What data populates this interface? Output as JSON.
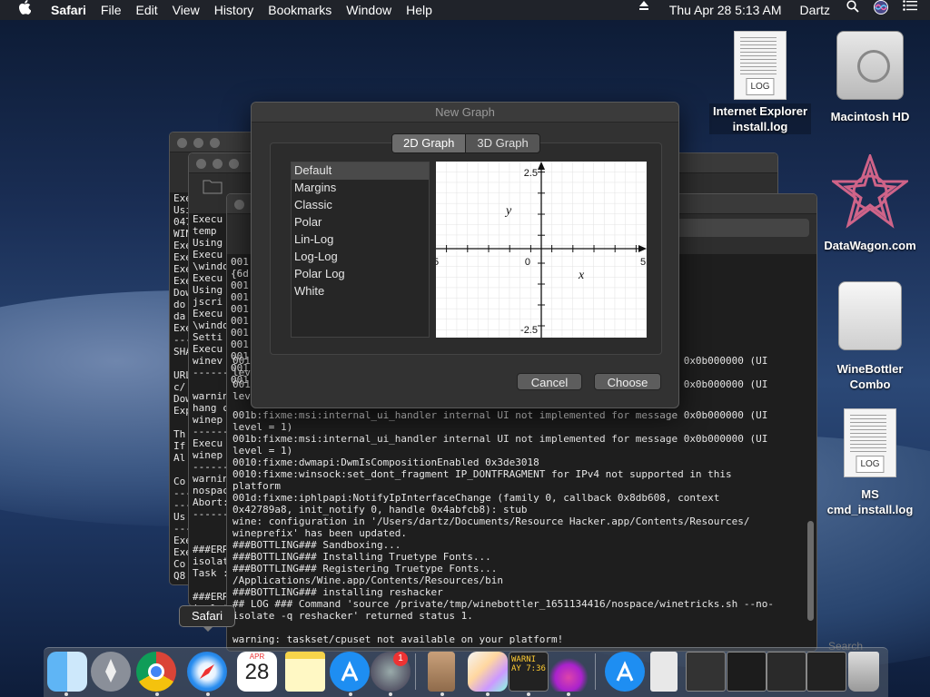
{
  "menubar": {
    "app_name": "Safari",
    "menus": [
      "File",
      "Edit",
      "View",
      "History",
      "Bookmarks",
      "Window",
      "Help"
    ],
    "datetime": "Thu Apr 28  5:13 AM",
    "user": "Dartz"
  },
  "desktop_icons": [
    {
      "label": "Internet Explorer\ninstall.log",
      "icon": "log-document-icon"
    },
    {
      "label": "Macintosh HD",
      "icon": "hard-drive-icon"
    },
    {
      "label": "DataWagon.com",
      "icon": "star-pattern-icon"
    },
    {
      "label": "WineBottler\nCombo",
      "icon": "disk-image-icon"
    },
    {
      "label": "MS\ncmd_install.log",
      "icon": "log-document-icon"
    }
  ],
  "log_tag": "LOG",
  "dialog": {
    "title": "New Graph",
    "tabs": [
      "2D Graph",
      "3D Graph"
    ],
    "active_tab": "2D Graph",
    "styles": [
      "Default",
      "Margins",
      "Classic",
      "Polar",
      "Lin-Log",
      "Log-Log",
      "Polar Log",
      "White"
    ],
    "selected_style": "Default",
    "preview": {
      "y_max_label": "2.5",
      "y_min_label": "-2.5",
      "x_min_label": "5",
      "x_max_label": "5",
      "origin_label": "0",
      "x_axis_label": "x",
      "y_axis_label": "y"
    },
    "cancel_label": "Cancel",
    "choose_label": "Choose"
  },
  "terminal_main_lines": [
    "001b:fixme:msi:internal_ui_handler internal UI not implemented for message 0x0b000000 (UI",
    "level = 1)",
    "001b:fixme:msi:internal_ui_handler internal UI not implemented for message 0x0b000000 (UI",
    "level = 1)",
    "0010:fixme:dwmapi:DwmIsCompositionEnabled 0x3de3018",
    "0010:fixme:winsock:set_dont_fragment IP_DONTFRAGMENT for IPv4 not supported in this",
    "platform",
    "001d:fixme:iphlpapi:NotifyIpInterfaceChange (family 0, callback 0x8db608, context",
    "0x42789a8, init_notify 0, handle 0x4abfcb8): stub",
    "wine: configuration in '/Users/dartz/Documents/Resource Hacker.app/Contents/Resources/",
    "wineprefix' has been updated.",
    "###BOTTLING### Sandboxing...",
    "###BOTTLING### Installing Truetype Fonts...",
    "###BOTTLING### Registering Truetype Fonts...",
    "/Applications/Wine.app/Contents/Resources/bin",
    "###BOTTLING### installing reshacker",
    "## LOG ### Command 'source /private/tmp/winebottler_1651134416/nospace/winetricks.sh --no-",
    "isolate -q reshacker' returned status 1.",
    "",
    "warning: taskset/cpuset not available on your platform!"
  ],
  "terminal_upper_lines": [
    "001b:fixme:msi:internal_ui_handler internal UI not implemented for message 0x0b000000 (UI",
    "level",
    "001b:fixme:msi:internal_ui_handler internal UI not implemented for message 0x0b000000 (UI",
    "level"
  ],
  "terminal_back_lines": [
    "Exe",
    "Usi",
    "047",
    "WIN",
    "Exe",
    "Exe",
    "Exe",
    "Exe",
    "Dow",
    "do",
    "da",
    "Exe",
    "---",
    "SHA",
    "",
    "URL",
    "c/",
    "Dow",
    "Exp",
    "",
    "Th",
    "If",
    "Al",
    "",
    "Co",
    "---",
    "---",
    "Us",
    "---",
    "Exe",
    "Exe",
    "Co",
    "Q8"
  ],
  "terminal_mid_lines": [
    "Execu",
    "temp",
    "Using",
    "Execu",
    "\\windo",
    "Execu",
    "Using",
    "jscri",
    "Execu",
    "\\windo",
    "Setti",
    "Execu",
    "winev",
    "------",
    "",
    "warnin",
    "hang c",
    "winep",
    "------",
    "Execu",
    "winep",
    "------",
    "warnin",
    "nospac",
    "Abort:",
    "------",
    "",
    "",
    "###ERR",
    "isolat",
    "Task :",
    "",
    "###ERR",
    "isolat",
    "Task :"
  ],
  "terminal_front_col": [
    "001",
    "{6d",
    "001",
    "001",
    "001",
    "001",
    "001",
    "001",
    "001",
    "001",
    "001"
  ],
  "safari_tooltip": "Safari",
  "calendar": {
    "month": "APR",
    "day": "28"
  },
  "badge_count": "1",
  "search_placeholder": "Search",
  "warning_thumb": "WARNI",
  "warning_thumb_time": "AY 7:36"
}
